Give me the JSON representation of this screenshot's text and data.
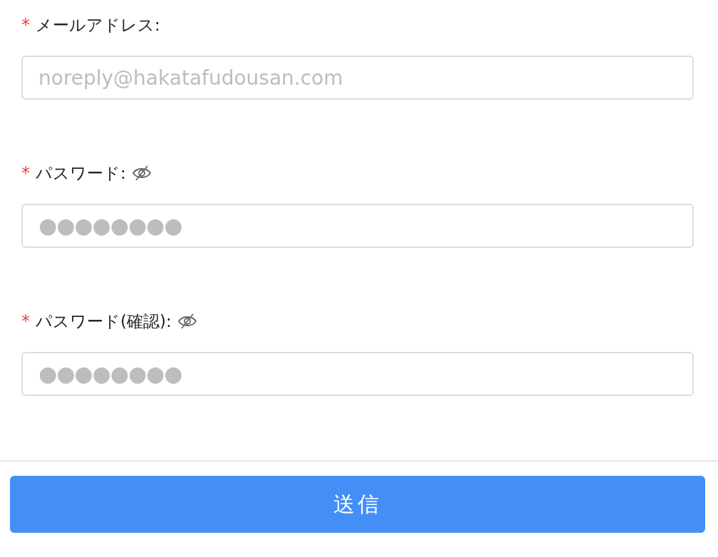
{
  "fields": [
    {
      "kind": "email",
      "marker": "*",
      "label": "メールアドレス:",
      "placeholder": "noreply@hakatafudousan.com"
    },
    {
      "kind": "password",
      "marker": "*",
      "label": "パスワード:",
      "revealed": false,
      "placeholder": "●●●●●●●●"
    },
    {
      "kind": "password",
      "marker": "*",
      "label": "パスワード(確認):",
      "revealed": false,
      "placeholder": "●●●●●●●●"
    }
  ],
  "submit_button": {
    "label": "送信"
  }
}
